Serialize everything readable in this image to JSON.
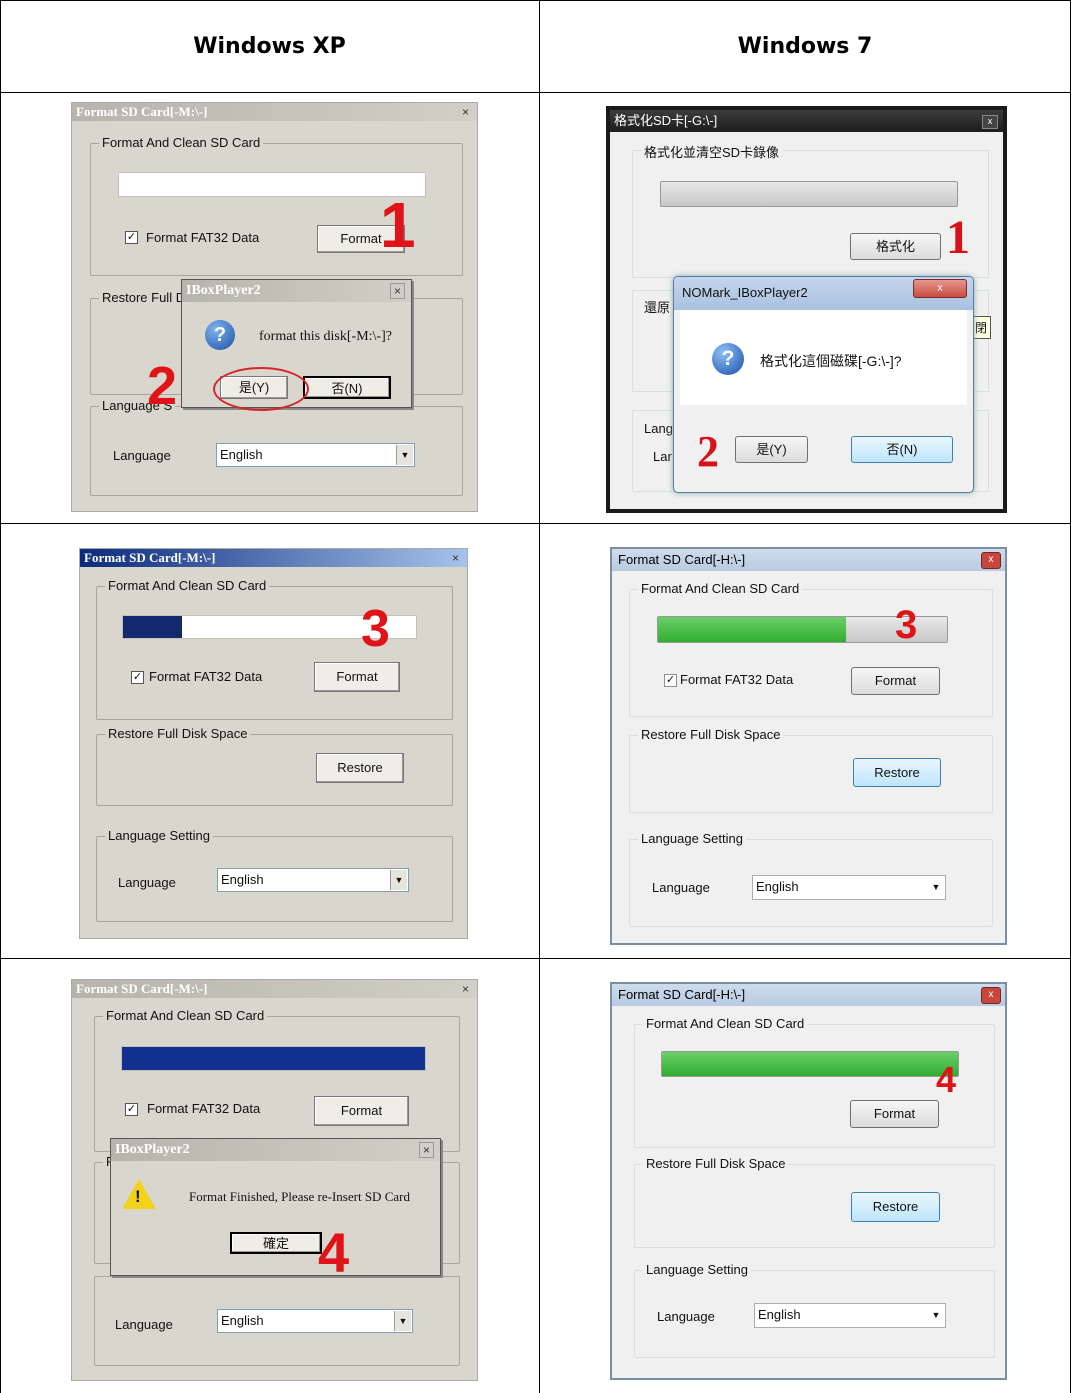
{
  "headers": {
    "xp": "Windows XP",
    "w7": "Windows 7"
  },
  "step_numbers": [
    "1",
    "2",
    "3",
    "4"
  ],
  "xp_common": {
    "window_title": "Format SD Card[-M:\\-]",
    "group_format": "Format And Clean SD Card",
    "checkbox_label": "Format FAT32 Data",
    "format_button": "Format",
    "group_restore": "Restore Full Disk Space",
    "group_restore_truncated": "Restore Full D",
    "restore_button": "Restore",
    "group_language": "Language Setting",
    "group_language_truncated": "Language S",
    "language_label": "Language",
    "language_value": "English",
    "close_glyph": "×"
  },
  "xp_row1_dialog": {
    "title": "IBoxPlayer2",
    "message": "format this disk[-M:\\-]?",
    "yes": "是(Y)",
    "no": "否(N)",
    "icon": "?"
  },
  "xp_row3_dialog": {
    "title": "IBoxPlayer2",
    "message": "Format Finished, Please re-Insert SD Card",
    "ok": "確定",
    "icon": "!"
  },
  "xp_row3_partial_letter": "F",
  "w7_row1": {
    "window_title": "格式化SD卡[-G:\\-]",
    "group_format": "格式化並清空SD卡錄像",
    "format_button": "格式化",
    "group_restore_truncated": "還原",
    "group_language_truncated": "Lang",
    "language_label_truncated": "Lar",
    "tooltip": "關閉",
    "dialog_title": "NOMark_IBoxPlayer2",
    "dialog_message": "格式化這個磁碟[-G:\\-]?",
    "yes": "是(Y)",
    "no": "否(N)",
    "icon": "?"
  },
  "w7_common": {
    "window_title": "Format SD Card[-H:\\-]",
    "group_format": "Format And Clean SD Card",
    "checkbox_label": "Format FAT32 Data",
    "format_button": "Format",
    "group_restore": "Restore Full Disk Space",
    "restore_button": "Restore",
    "group_language": "Language Setting",
    "language_label": "Language",
    "language_value": "English",
    "close_glyph": "x"
  },
  "progress": {
    "xp_row2": 0.2,
    "xp_row3": 1.0,
    "w7_row2": 0.65,
    "w7_row3": 1.0
  }
}
